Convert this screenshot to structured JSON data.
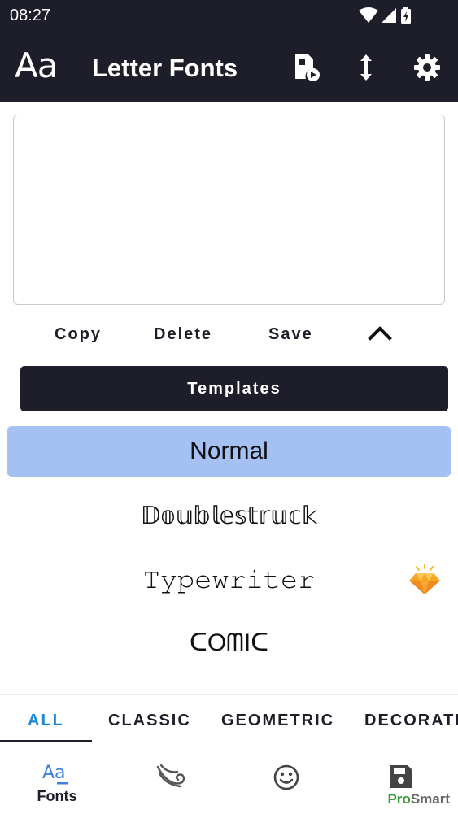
{
  "status_bar": {
    "time": "08:27",
    "icons": [
      "wifi-icon",
      "signal-icon",
      "battery-charging-icon"
    ]
  },
  "app_bar": {
    "logo": "Aa",
    "title": "Letter Fonts",
    "icons": [
      "video-file-icon",
      "vertical-arrows-icon",
      "gear-icon"
    ]
  },
  "editor": {
    "value": "",
    "placeholder": ""
  },
  "actions": {
    "copy": "Copy",
    "delete": "Delete",
    "save": "Save"
  },
  "templates_label": "Templates",
  "fonts": [
    {
      "label": "Normal",
      "selected": true
    },
    {
      "label": "𝔻𝕠𝕦𝕓𝕝𝕖𝕤𝕥𝕣𝕦𝕔𝕜",
      "selected": false
    },
    {
      "label": "𝚃𝚢𝚙𝚎𝚠𝚛𝚒𝚝𝚎𝚛",
      "selected": false,
      "badge": "premium-diamond-icon"
    },
    {
      "label": "ᑕOᗰIᑕ",
      "selected": false
    }
  ],
  "tabs": [
    {
      "label": "ALL",
      "active": true
    },
    {
      "label": "CLASSIC",
      "active": false
    },
    {
      "label": "GEOMETRIC",
      "active": false
    },
    {
      "label": "DECORATI",
      "active": false
    }
  ],
  "bottom_nav": [
    {
      "label": "Fonts",
      "icon": "fonts-icon",
      "active": true
    },
    {
      "label": "",
      "icon": "swirl-icon"
    },
    {
      "label": "",
      "icon": "smiley-icon"
    },
    {
      "label": "",
      "icon": "save-icon"
    }
  ],
  "watermark": {
    "part1": "Pro",
    "part2": "Smart"
  },
  "colors": {
    "primary": "#1d1e29",
    "selected": "#a5c0f3",
    "accent": "#1e88d6",
    "watermark_green": "#3a9b3a"
  }
}
